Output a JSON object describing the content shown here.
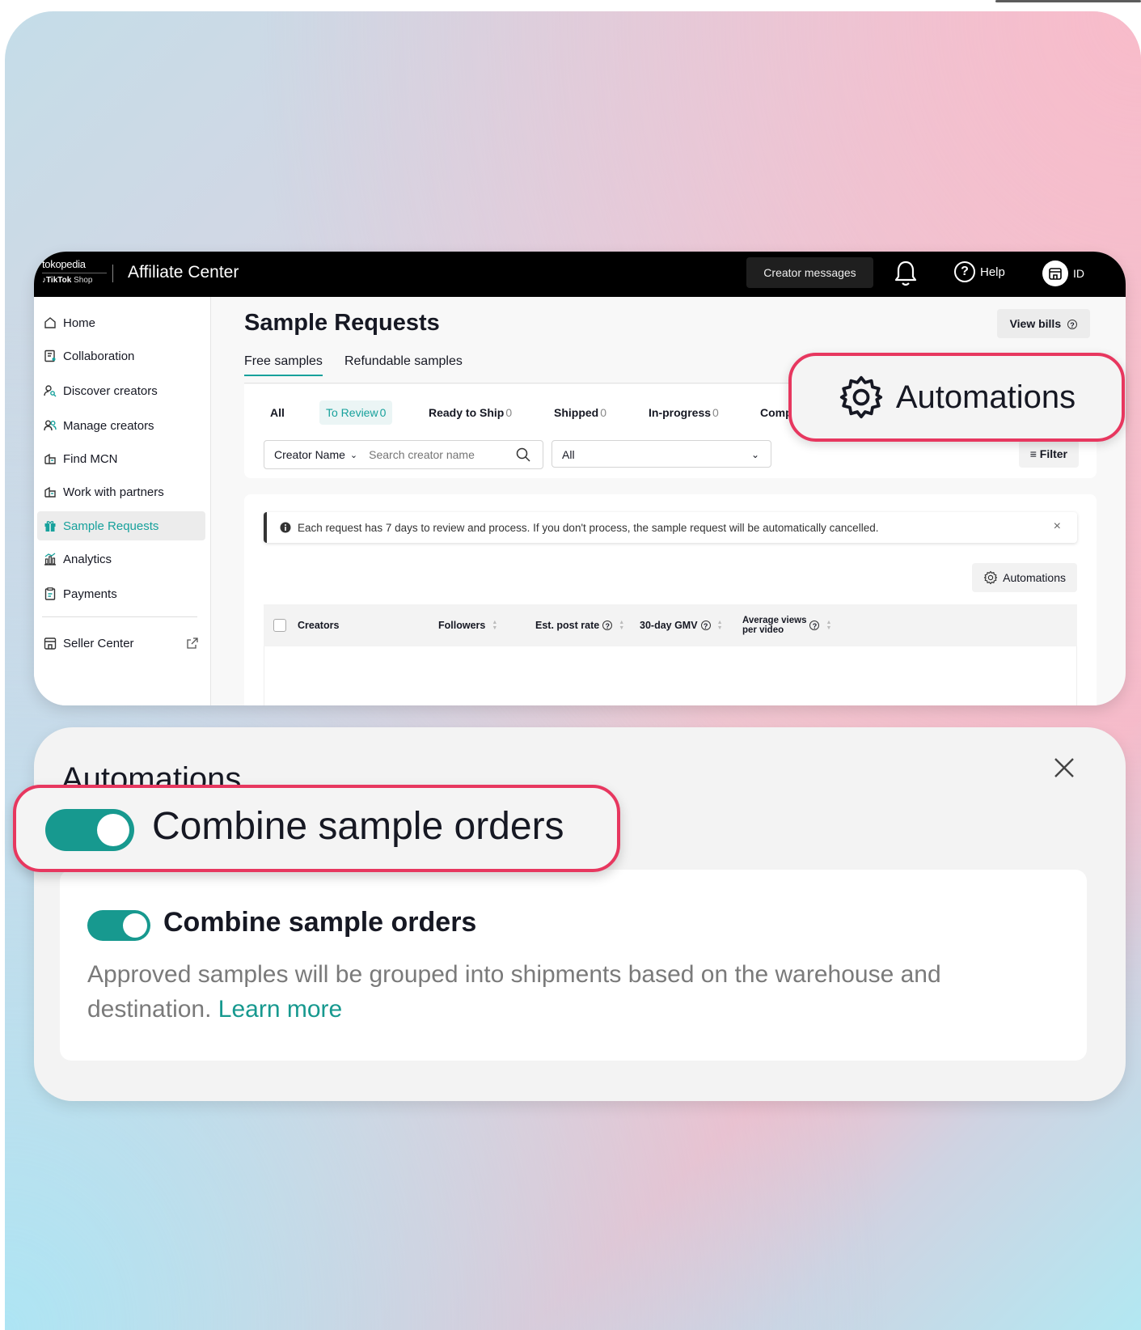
{
  "brand": {
    "line1": "tokopedia",
    "line2_bold": "TikTok",
    "line2_rest": "Shop"
  },
  "header": {
    "app_title": "Affiliate Center",
    "creator_messages": "Creator messages",
    "help": "Help",
    "store_label": "ID"
  },
  "sidebar": {
    "items": [
      {
        "label": "Home",
        "icon": "home-icon"
      },
      {
        "label": "Collaboration",
        "icon": "collaboration-icon"
      },
      {
        "label": "Discover creators",
        "icon": "discover-icon"
      },
      {
        "label": "Manage creators",
        "icon": "manage-creators-icon"
      },
      {
        "label": "Find MCN",
        "icon": "mcn-icon"
      },
      {
        "label": "Work with partners",
        "icon": "partners-icon"
      },
      {
        "label": "Sample Requests",
        "icon": "gift-icon",
        "active": true
      },
      {
        "label": "Analytics",
        "icon": "analytics-icon"
      },
      {
        "label": "Payments",
        "icon": "payments-icon"
      }
    ],
    "seller_center": "Seller Center"
  },
  "main": {
    "page_title": "Sample Requests",
    "view_bills": "View bills",
    "tabs": [
      "Free samples",
      "Refundable samples"
    ],
    "status_tabs": [
      {
        "label": "All",
        "count": ""
      },
      {
        "label": "To Review",
        "count": "0"
      },
      {
        "label": "Ready to Ship",
        "count": "0"
      },
      {
        "label": "Shipped",
        "count": "0"
      },
      {
        "label": "In-progress",
        "count": "0"
      },
      {
        "label": "Comp",
        "count": ""
      }
    ],
    "search": {
      "field_label": "Creator Name",
      "placeholder": "Search creator name"
    },
    "select_all": "All",
    "filter": "Filter",
    "notice": "Each request has 7 days to review and process. If you don't process, the sample request will be automatically cancelled.",
    "automations_button": "Automations",
    "table_headers": {
      "creators": "Creators",
      "followers": "Followers",
      "post_rate": "Est. post rate",
      "gmv": "30-day GMV",
      "avg_views_1": "Average views",
      "avg_views_2": "per video"
    }
  },
  "callout_automations": "Automations",
  "automations_panel": {
    "title": "Automations",
    "callout_label": "Combine sample orders",
    "option_title": "Combine sample orders",
    "option_desc": "Approved samples will be grouped into shipments based on the warehouse and destination.",
    "learn_more": "Learn more",
    "toggle_on": true
  },
  "colors": {
    "accent": "#17998f",
    "highlight": "#e7375f",
    "topbar": "#000000"
  }
}
